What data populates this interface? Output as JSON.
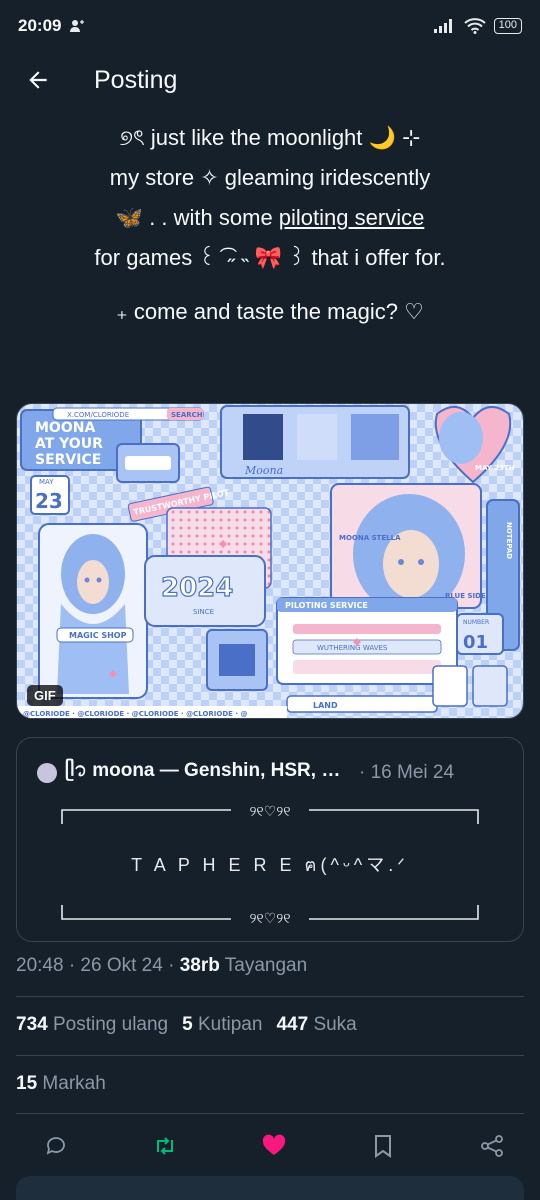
{
  "status_bar": {
    "time": "20:09",
    "battery": "100"
  },
  "header": {
    "title": "Posting"
  },
  "post": {
    "lines": [
      {
        "text": "୭ৎ  just like the moonlight 🌙  ⊹"
      },
      {
        "text": "my store ✧  gleaming iridescently"
      },
      {
        "pre": "🦋  . .  with  some  ",
        "link": "piloting service",
        "post": ""
      },
      {
        "text": "for  games ꒰ ͡ ˶ ˵ 🎀 ꒱  that i offer for."
      },
      {
        "text": "₊ come and taste the magic? ♡"
      }
    ]
  },
  "media": {
    "badge": "GIF",
    "texts": {
      "t1": "MOONA",
      "t2": "AT YOUR",
      "t3": "SERVICE",
      "search": "SEARCH",
      "url": "X.COM/CLORIODE",
      "may": "MAY",
      "day": "23",
      "trust": "TRUSTWORTHY PILOT",
      "year": "2024",
      "since": "SINCE",
      "moona": "Moona",
      "stella": "MOONA STELLA",
      "piloting": "PILOTING SERVICE",
      "ww": "WUTHERING WAVES",
      "blue": "BLUE SIDE",
      "number": "NUMBER",
      "num": "01",
      "land": "LAND",
      "notepad": "NOTEPAD",
      "magic": "MAGIC SHOP",
      "may2": "MAY 23TH",
      "footer": "@CLORIODE · @CLORIODE · @CLORIODE · @CLORIODE · @"
    }
  },
  "quote": {
    "name": "ᥫ᭡ moona — Genshin, HSR, Wu...",
    "date": "· 16 Mei 24",
    "tap": "T A P  H E R E  ฅ(^ᵕ^マ.ᐟ",
    "ornament": "୨୧♡୨୧"
  },
  "meta": {
    "time": "20:48 · 26 Okt 24 · ",
    "views": "38rb",
    "views_label": " Tayangan"
  },
  "stats": {
    "reposts": "734",
    "reposts_label": "Posting ulang",
    "quotes": "5",
    "quotes_label": "Kutipan",
    "likes": "447",
    "likes_label": "Suka",
    "bookmarks": "15",
    "bookmarks_label": "Markah"
  },
  "colors": {
    "like": "#f91880",
    "repost": "#00ba7c",
    "muted": "#8b98a5"
  }
}
